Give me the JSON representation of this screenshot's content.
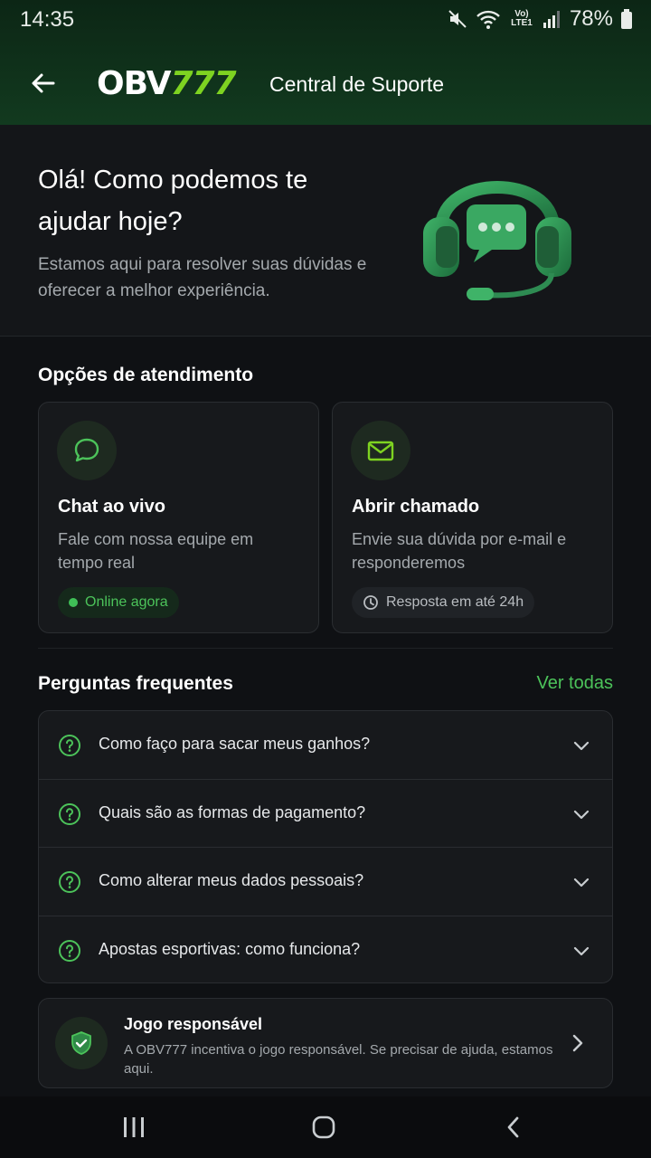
{
  "status": {
    "time": "14:35",
    "network": "Vo) LTE1",
    "battery": "78%"
  },
  "appbar": {
    "logo_white": "OBV",
    "logo_green": "777",
    "title": "Central de Suporte"
  },
  "hero": {
    "title": "Olá! Como podemos te ajudar hoje?",
    "subtitle": "Estamos aqui para resolver suas dúvidas e oferecer a melhor experiência."
  },
  "options": {
    "heading": "Opções de atendimento",
    "cards": [
      {
        "title": "Chat ao vivo",
        "description": "Fale com nossa equipe em tempo real",
        "badge": "Online agora",
        "icon": "chat-bubble-icon"
      },
      {
        "title": "Abrir chamado",
        "description": "Envie sua dúvida por e-mail e responderemos",
        "badge": "Resposta em até 24h",
        "icon": "mail-icon"
      }
    ]
  },
  "faq": {
    "heading": "Perguntas frequentes",
    "see_all": "Ver todas",
    "items": [
      {
        "question": "Como faço para sacar meus ganhos?"
      },
      {
        "question": "Quais são as formas de pagamento?"
      },
      {
        "question": "Como alterar meus dados pessoais?"
      },
      {
        "question": "Apostas esportivas: como funciona?"
      }
    ]
  },
  "responsible": {
    "title": "Jogo responsável",
    "description": "A OBV777 incentiva o jogo responsável. Se precisar de ajuda, estamos aqui."
  },
  "colors": {
    "accent": "#4cc35a",
    "header_bg": "#123a1f",
    "page_bg": "#0f1114"
  }
}
